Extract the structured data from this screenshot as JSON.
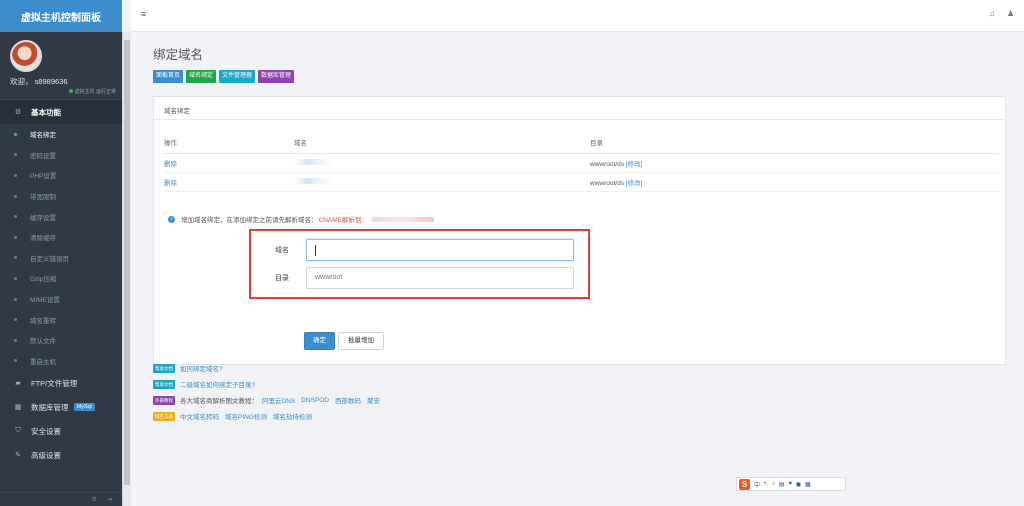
{
  "brand": "虚拟主机控制面板",
  "user": {
    "welcome": "欢迎，",
    "name": "s8989636",
    "status": "虚拟主机  运行正常"
  },
  "menu": {
    "basic": "基本功能",
    "subs": [
      "域名绑定",
      "密码设置",
      "PHP设置",
      "带宽限制",
      "缓存设置",
      "清除缓存",
      "自定义错误页",
      "Gzip压缩",
      "MIME设置",
      "域名重转",
      "默认文件",
      "重启主机"
    ],
    "ftp": "FTP/文件管理",
    "db": "数据库管理",
    "db_badge": "MySql",
    "security": "安全设置",
    "advanced": "高级设置"
  },
  "page": {
    "title": "绑定域名"
  },
  "quick_links": [
    {
      "label": "面板首页",
      "color": "#3c8dcd"
    },
    {
      "label": "域名绑定",
      "color": "#1fa64a"
    },
    {
      "label": "文件管理器",
      "color": "#1aa8c2"
    },
    {
      "label": "数据库管理",
      "color": "#8e44ad"
    }
  ],
  "card": {
    "title": "域名绑定",
    "headers": [
      "操作",
      "域名",
      "目录"
    ],
    "rows": [
      {
        "action": "删除",
        "dir": "wwwroot/ds",
        "edit": "[修改]"
      },
      {
        "action": "删除",
        "dir": "wwwroot/ds",
        "edit": "[修改]"
      }
    ],
    "notice": "增加域名绑定，在添加绑定之前请先解析域名：",
    "notice_red": "CNAME解析到："
  },
  "form": {
    "domain_label": "域名",
    "domain_value": "",
    "dir_label": "目录",
    "dir_value": "wwwroot",
    "submit": "确定",
    "batch": "批量增加"
  },
  "help": [
    {
      "tag": "帮助文档",
      "tag_color": "#1aa8c2",
      "text": "",
      "links": [
        "如何绑定域名?"
      ]
    },
    {
      "tag": "帮助文档",
      "tag_color": "#1aa8c2",
      "text": "",
      "links": [
        "二级域名如何绑定子目录?"
      ]
    },
    {
      "tag": "外部教程",
      "tag_color": "#8e44ad",
      "text": "各大域名商解析图文教程：",
      "links": [
        "阿里云DNS",
        "DNSPOD",
        "西部数码",
        "聚安"
      ]
    },
    {
      "tag": "域名工具",
      "tag_color": "#f0ad1e",
      "text": "",
      "links": [
        "中文域名转码",
        "域名PING检测",
        "域名劫持检测"
      ]
    }
  ],
  "ime": {
    "logo": "S",
    "text": "中"
  }
}
